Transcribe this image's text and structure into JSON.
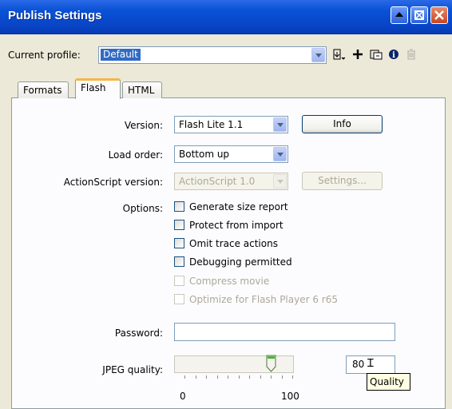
{
  "window": {
    "title": "Publish Settings",
    "controls": [
      "minimize-icon",
      "restore-icon",
      "close-icon"
    ]
  },
  "profile": {
    "label": "Current profile:",
    "value": "Default",
    "tools": [
      {
        "name": "import-export-icon",
        "glyph": "⇩"
      },
      {
        "name": "add-profile-icon",
        "glyph": "+"
      },
      {
        "name": "duplicate-profile-icon",
        "glyph": "⧉"
      },
      {
        "name": "profile-info-icon",
        "glyph": "❶"
      },
      {
        "name": "delete-profile-icon",
        "glyph": "🗑"
      }
    ]
  },
  "tabs": [
    {
      "label": "Formats",
      "active": false
    },
    {
      "label": "Flash",
      "active": true
    },
    {
      "label": "HTML",
      "active": false
    }
  ],
  "flash": {
    "version_label": "Version:",
    "version_value": "Flash Lite 1.1",
    "info_button": "Info",
    "load_order_label": "Load order:",
    "load_order_value": "Bottom up",
    "actionscript_label": "ActionScript version:",
    "actionscript_value": "ActionScript 1.0",
    "settings_button": "Settings...",
    "options_label": "Options:",
    "options": [
      {
        "label": "Generate size report",
        "checked": false,
        "enabled": true
      },
      {
        "label": "Protect from import",
        "checked": false,
        "enabled": true
      },
      {
        "label": "Omit trace actions",
        "checked": false,
        "enabled": true
      },
      {
        "label": "Debugging permitted",
        "checked": false,
        "enabled": true
      },
      {
        "label": "Compress movie",
        "checked": false,
        "enabled": false
      },
      {
        "label": "Optimize for Flash Player 6 r65",
        "checked": false,
        "enabled": false
      }
    ],
    "password_label": "Password:",
    "password_value": "",
    "jpeg_label": "JPEG quality:",
    "jpeg_value": "80",
    "jpeg_fraction": 0.8,
    "scale_min": "0",
    "scale_max": "100",
    "tooltip": "Quality"
  }
}
